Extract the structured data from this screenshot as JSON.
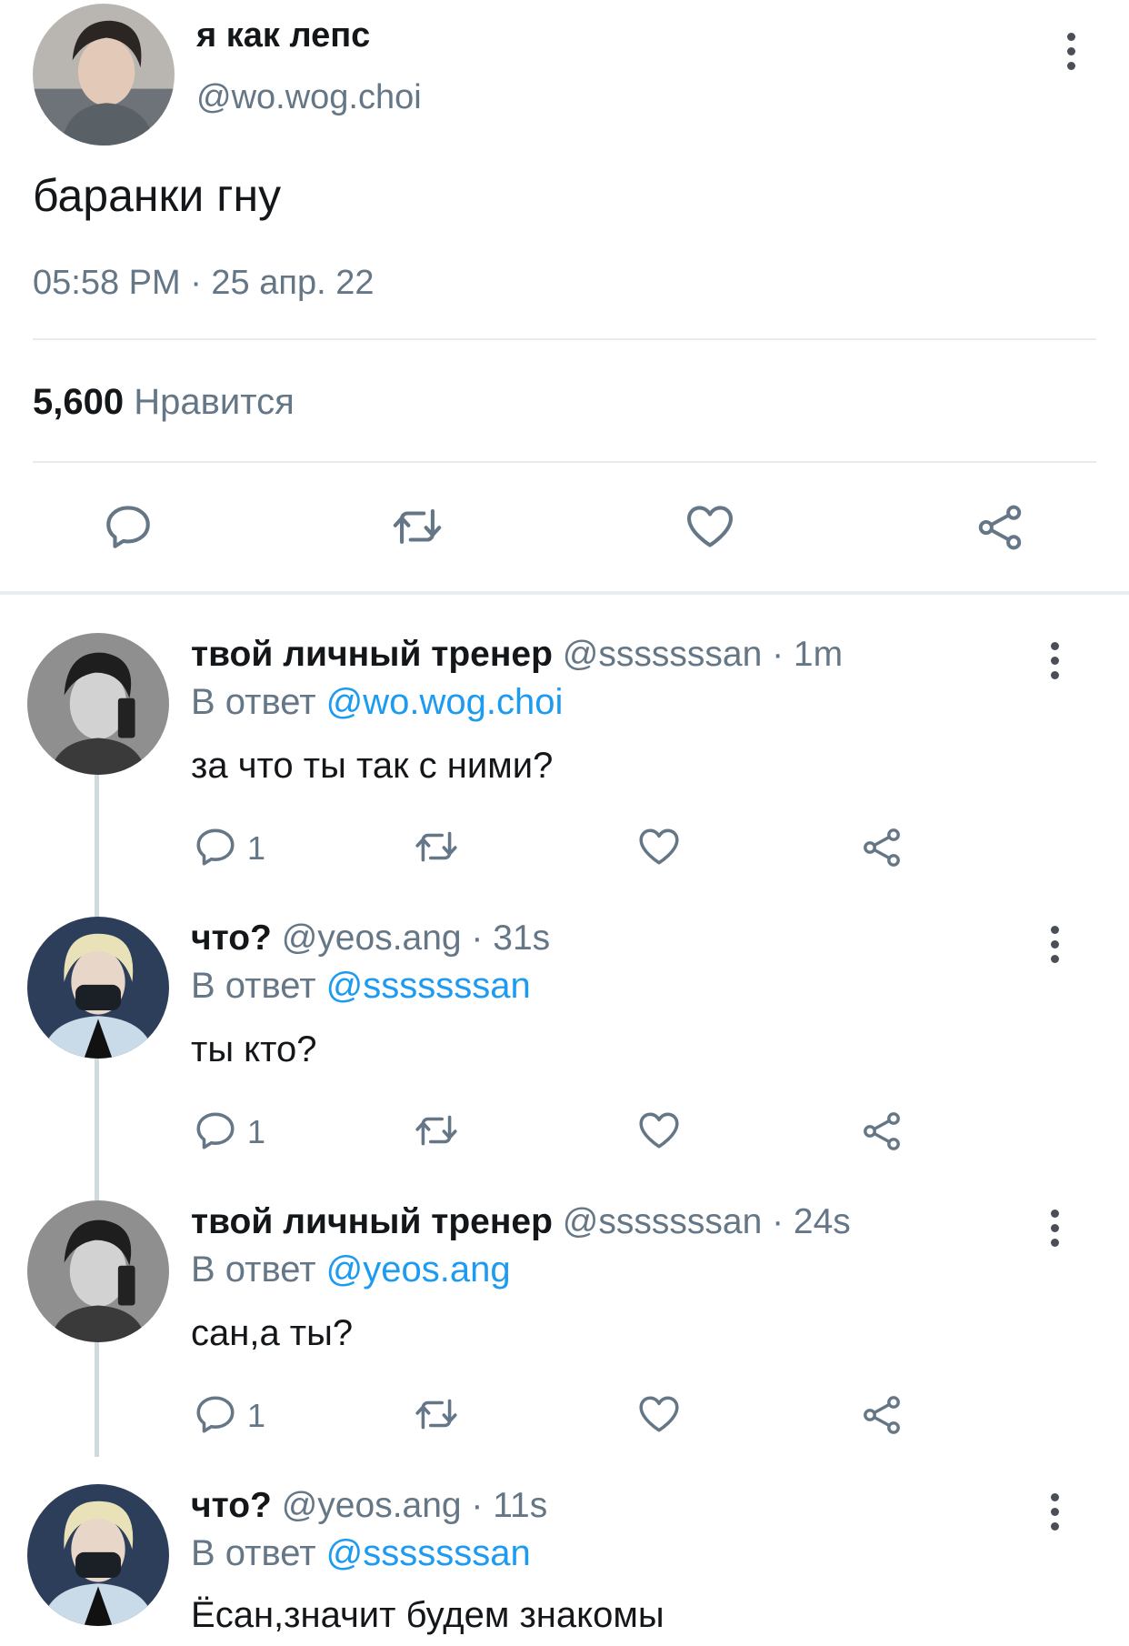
{
  "main_tweet": {
    "display_name": "я как лепс",
    "handle": "@wo.wog.choi",
    "text": "баранки гну",
    "timestamp": "05:58 PM · 25 апр. 22",
    "likes_count": "5,600",
    "likes_label": "Нравится",
    "avatar": "user-photo"
  },
  "replies": [
    {
      "display_name": "твой личный тренер",
      "meta": "@sssssssan · 1m",
      "reply_prefix": "В ответ",
      "reply_to": "@wo.wog.choi",
      "text": "за что ты так с ними?",
      "reply_count": "1"
    },
    {
      "display_name": "что?",
      "meta": "@yeos.ang · 31s",
      "reply_prefix": "В ответ",
      "reply_to": "@sssssssan",
      "text": "ты кто?",
      "reply_count": "1"
    },
    {
      "display_name": "твой личный тренер",
      "meta": "@sssssssan · 24s",
      "reply_prefix": "В ответ",
      "reply_to": "@yeos.ang",
      "text": "сан,а ты?",
      "reply_count": "1"
    },
    {
      "display_name": "что?",
      "meta": "@yeos.ang · 11s",
      "reply_prefix": "В ответ",
      "reply_to": "@sssssssan",
      "text": "Ёсан,значит будем знакомы"
    }
  ],
  "icons": {
    "reply": "speech-bubble-icon",
    "retweet": "retweet-icon",
    "like": "heart-icon",
    "share": "share-icon",
    "more": "more-vertical-icon"
  },
  "colors": {
    "link": "#1d9bf0",
    "secondary_text": "#657786",
    "icon": "#657786",
    "divider": "#e6ecf0"
  }
}
